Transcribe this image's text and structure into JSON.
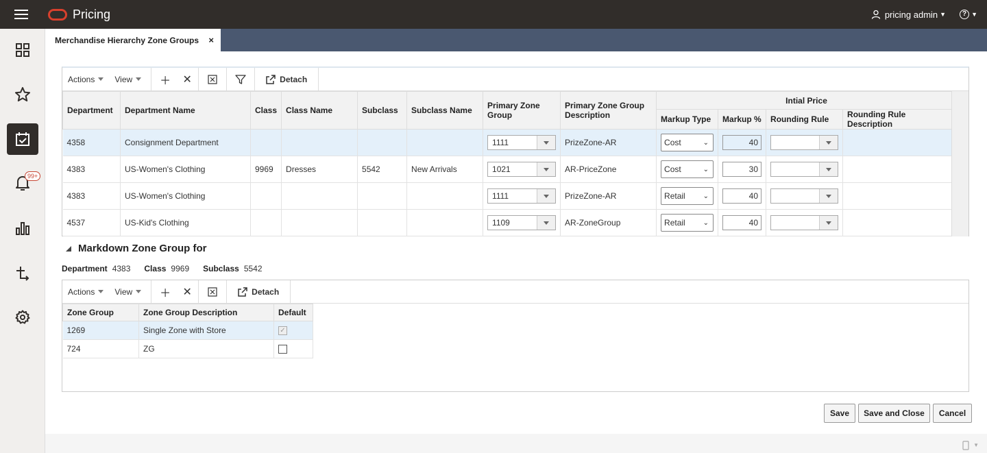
{
  "app": {
    "title": "Pricing",
    "user": "pricing admin"
  },
  "nav": {
    "badge": "99+"
  },
  "tab": {
    "label": "Merchandise Hierarchy Zone Groups",
    "close": "×"
  },
  "toolbar1": {
    "actions": "Actions",
    "view": "View",
    "detach": "Detach"
  },
  "grid1": {
    "group_header": "Intial Price",
    "columns": {
      "department": "Department",
      "department_name": "Department Name",
      "class": "Class",
      "class_name": "Class Name",
      "subclass": "Subclass",
      "subclass_name": "Subclass Name",
      "primary_zone_group": "Primary Zone Group",
      "primary_zone_group_desc": "Primary Zone Group Description",
      "markup_type": "Markup Type",
      "markup_pct": "Markup %",
      "rounding_rule": "Rounding Rule",
      "rounding_rule_desc": "Rounding Rule Description"
    },
    "rows": [
      {
        "department": "4358",
        "department_name": "Consignment Department",
        "class": "",
        "class_name": "",
        "subclass": "",
        "subclass_name": "",
        "zone_group": "1111",
        "zone_desc": "PrizeZone-AR",
        "markup_type": "Cost",
        "markup_pct": "40",
        "rounding_rule": "",
        "rounding_desc": ""
      },
      {
        "department": "4383",
        "department_name": "US-Women's Clothing",
        "class": "9969",
        "class_name": "Dresses",
        "subclass": "5542",
        "subclass_name": "New Arrivals",
        "zone_group": "1021",
        "zone_desc": "AR-PriceZone",
        "markup_type": "Cost",
        "markup_pct": "30",
        "rounding_rule": "",
        "rounding_desc": ""
      },
      {
        "department": "4383",
        "department_name": "US-Women's Clothing",
        "class": "",
        "class_name": "",
        "subclass": "",
        "subclass_name": "",
        "zone_group": "1111",
        "zone_desc": "PrizeZone-AR",
        "markup_type": "Retail",
        "markup_pct": "40",
        "rounding_rule": "",
        "rounding_desc": ""
      },
      {
        "department": "4537",
        "department_name": "US-Kid's Clothing",
        "class": "",
        "class_name": "",
        "subclass": "",
        "subclass_name": "",
        "zone_group": "1109",
        "zone_desc": "AR-ZoneGroup",
        "markup_type": "Retail",
        "markup_pct": "40",
        "rounding_rule": "",
        "rounding_desc": ""
      }
    ]
  },
  "markdown": {
    "title": "Markdown Zone Group for",
    "department_label": "Department",
    "department_value": "4383",
    "class_label": "Class",
    "class_value": "9969",
    "subclass_label": "Subclass",
    "subclass_value": "5542"
  },
  "toolbar2": {
    "actions": "Actions",
    "view": "View",
    "detach": "Detach"
  },
  "grid2": {
    "columns": {
      "zone_group": "Zone Group",
      "zone_group_desc": "Zone Group Description",
      "default": "Default"
    },
    "rows": [
      {
        "zone_group": "1269",
        "zone_group_desc": "Single Zone with Store",
        "default": true
      },
      {
        "zone_group": "724",
        "zone_group_desc": "ZG",
        "default": false
      }
    ]
  },
  "buttons": {
    "save": "Save",
    "save_close": "Save and Close",
    "cancel": "Cancel"
  },
  "colors": {
    "header_bg": "#312d2a",
    "tab_strip": "#4a5870",
    "logo": "#d8402d",
    "selected_row": "#e4f0fa"
  }
}
